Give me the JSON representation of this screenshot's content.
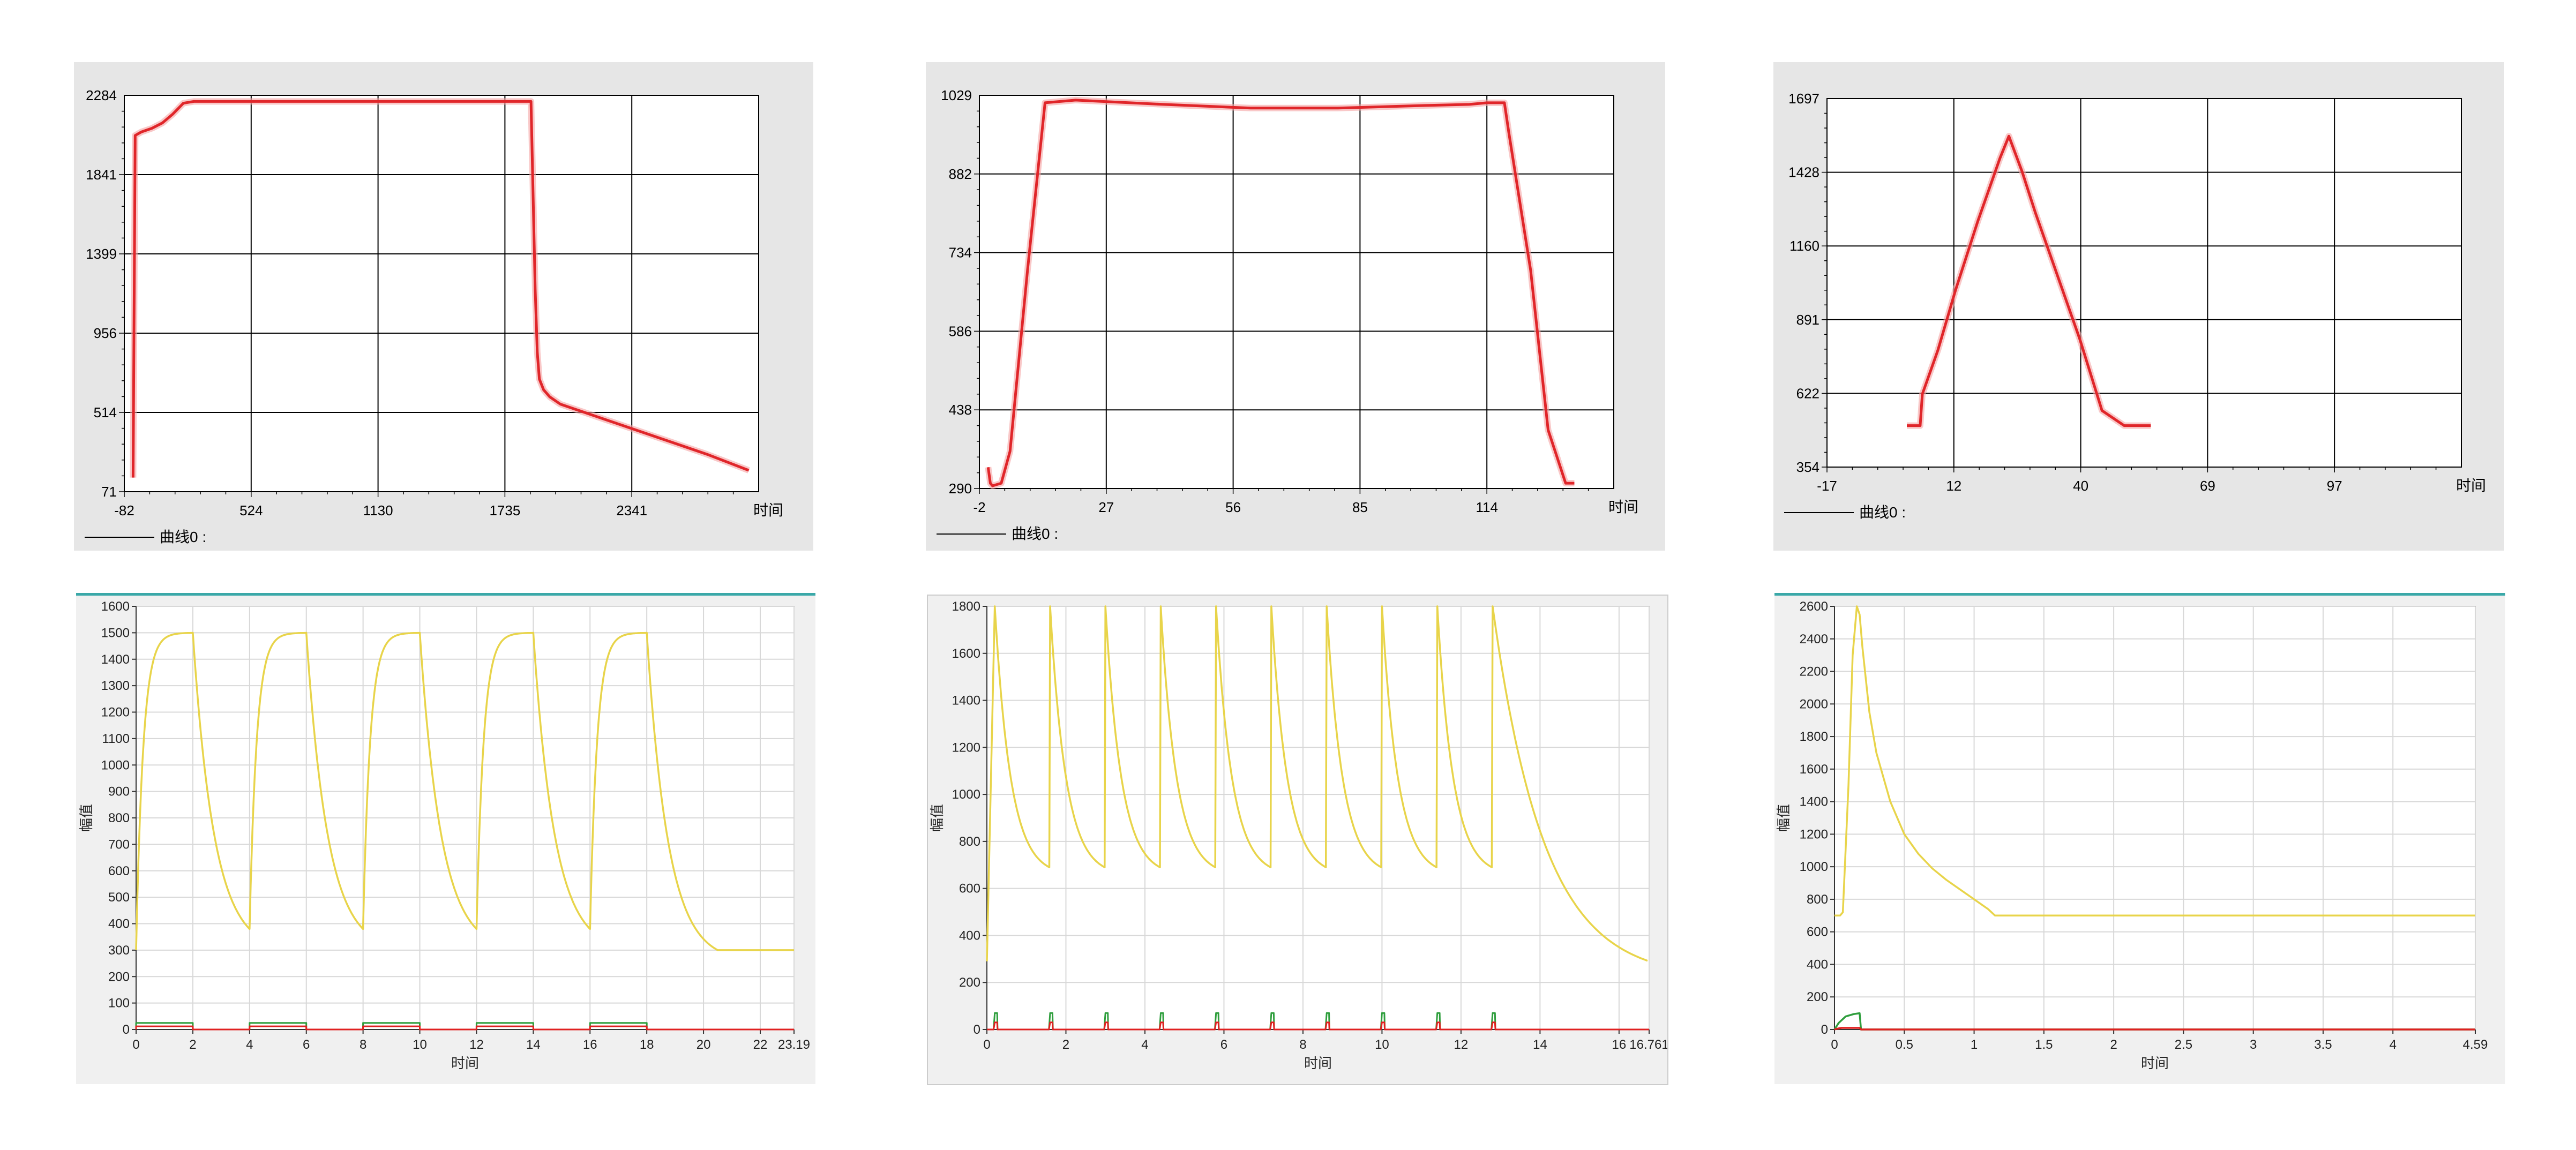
{
  "colors": {
    "red_curve": "#e0262a",
    "yellow": "#e8d44a",
    "green": "#2e9e3c",
    "red": "#e02020",
    "teal_border": "#3aa8a8"
  },
  "legend_label": "曲线0 :",
  "chart_data": [
    {
      "type": "line",
      "title": "",
      "xlabel": "时间",
      "ylabel": "",
      "xticks": [
        "-82",
        "524",
        "1130",
        "1735",
        "2341"
      ],
      "yticks": [
        "71",
        "514",
        "956",
        "1399",
        "1841",
        "2284"
      ],
      "xlim": [
        -82,
        2947
      ],
      "ylim": [
        71,
        2284
      ],
      "grid": true,
      "legend": "bottom-left",
      "series": [
        {
          "name": "曲线0",
          "x": [
            -40,
            -30,
            0,
            50,
            100,
            150,
            200,
            250,
            350,
            500,
            800,
            1200,
            1800,
            1860,
            1880,
            1890,
            1900,
            1920,
            1950,
            2000,
            2100,
            2400,
            2700,
            2900
          ],
          "y": [
            150,
            2060,
            2080,
            2100,
            2130,
            2180,
            2240,
            2250,
            2250,
            2250,
            2250,
            2250,
            2250,
            2250,
            1200,
            850,
            700,
            640,
            600,
            560,
            520,
            400,
            280,
            190
          ]
        }
      ]
    },
    {
      "type": "line",
      "title": "",
      "xlabel": "时间",
      "ylabel": "",
      "xticks": [
        "-2",
        "27",
        "56",
        "85",
        "114"
      ],
      "yticks": [
        "290",
        "438",
        "586",
        "734",
        "882",
        "1029"
      ],
      "xlim": [
        -2,
        143
      ],
      "ylim": [
        290,
        1029
      ],
      "grid": true,
      "legend": "bottom-left",
      "series": [
        {
          "name": "曲线0",
          "x": [
            0,
            0.5,
            1,
            3,
            5,
            9,
            13,
            20,
            40,
            60,
            80,
            100,
            110,
            114,
            118,
            119,
            124,
            128,
            132,
            134
          ],
          "y": [
            330,
            300,
            295,
            300,
            360,
            700,
            1015,
            1020,
            1012,
            1005,
            1005,
            1010,
            1012,
            1015,
            1015,
            960,
            700,
            400,
            300,
            300
          ]
        }
      ]
    },
    {
      "type": "line",
      "title": "",
      "xlabel": "时间",
      "ylabel": "",
      "xticks": [
        "-17",
        "12",
        "40",
        "69",
        "97"
      ],
      "yticks": [
        "354",
        "622",
        "891",
        "1160",
        "1428",
        "1697"
      ],
      "xlim": [
        -17,
        126
      ],
      "ylim": [
        354,
        1697
      ],
      "grid": true,
      "legend": "bottom-left",
      "series": [
        {
          "name": "曲线0",
          "x": [
            1,
            4,
            4.5,
            8,
            12,
            17,
            22,
            24,
            27,
            30,
            35,
            40,
            45,
            50,
            56
          ],
          "y": [
            505,
            505,
            620,
            780,
            1000,
            1250,
            1480,
            1560,
            1430,
            1280,
            1050,
            820,
            560,
            505,
            505
          ]
        }
      ]
    },
    {
      "type": "line",
      "title": "",
      "xlabel": "时间",
      "ylabel": "幅值",
      "xticks": [
        "0",
        "2",
        "4",
        "6",
        "8",
        "10",
        "12",
        "14",
        "16",
        "18",
        "20",
        "22",
        "23.19"
      ],
      "yticks": [
        "0",
        "100",
        "200",
        "300",
        "400",
        "500",
        "600",
        "700",
        "800",
        "900",
        "1000",
        "1100",
        "1200",
        "1300",
        "1400",
        "1500",
        "1600"
      ],
      "xlim": [
        0,
        23.19
      ],
      "ylim": [
        0,
        1600
      ],
      "grid": true,
      "series": [
        {
          "color": "yellow",
          "segments": [
            {
              "start": 0,
              "up": 2,
              "low": 300,
              "high": 1500,
              "tau_up": 0.25,
              "tau_down": 0.75,
              "down_end": 4
            },
            {
              "start": 4,
              "up": 2,
              "low": 380,
              "high": 1500,
              "tau_up": 0.25,
              "tau_down": 0.75,
              "down_end": 8
            },
            {
              "start": 8,
              "up": 2,
              "low": 380,
              "high": 1500,
              "tau_up": 0.25,
              "tau_down": 0.75,
              "down_end": 12
            },
            {
              "start": 12,
              "up": 2,
              "low": 380,
              "high": 1500,
              "tau_up": 0.25,
              "tau_down": 0.75,
              "down_end": 16
            },
            {
              "start": 16,
              "up": 2,
              "low": 380,
              "high": 1500,
              "tau_up": 0.25,
              "tau_down": 0.75,
              "down_end": 20.5
            }
          ],
          "tail": {
            "x": [
              20.5,
              23.19
            ],
            "y": [
              300,
              300
            ]
          }
        },
        {
          "color": "green",
          "pulses": [
            [
              0,
              2
            ],
            [
              4,
              6
            ],
            [
              8,
              10
            ],
            [
              12,
              14
            ],
            [
              16,
              18
            ]
          ],
          "value": 25,
          "base": 0
        },
        {
          "color": "red",
          "pulses": [
            [
              0,
              2
            ],
            [
              4,
              6
            ],
            [
              8,
              10
            ],
            [
              12,
              14
            ],
            [
              16,
              18
            ]
          ],
          "value": 12,
          "base": 0
        }
      ]
    },
    {
      "type": "line",
      "title": "",
      "xlabel": "时间",
      "ylabel": "幅值",
      "xticks": [
        "0",
        "2",
        "4",
        "6",
        "8",
        "10",
        "12",
        "14",
        "16",
        "16.761"
      ],
      "yticks": [
        "0",
        "200",
        "400",
        "600",
        "800",
        "1000",
        "1200",
        "1400",
        "1600",
        "1800"
      ],
      "xlim": [
        0,
        16.761
      ],
      "ylim": [
        0,
        1800
      ],
      "grid": true,
      "series": [
        {
          "color": "yellow",
          "spikes": [
            0.2,
            1.6,
            3.0,
            4.4,
            5.8,
            7.2,
            8.6,
            10.0,
            11.4,
            12.8
          ],
          "peak": 1800,
          "valley": 690,
          "first_low": 290,
          "tail_end": [
            16.761,
            290
          ]
        },
        {
          "color": "green",
          "spikes": [
            0.2,
            1.6,
            3.0,
            4.4,
            5.8,
            7.2,
            8.6,
            10.0,
            11.4,
            12.8
          ],
          "value": 70
        },
        {
          "color": "red",
          "spikes": [
            0.2,
            1.6,
            3.0,
            4.4,
            5.8,
            7.2,
            8.6,
            10.0,
            11.4,
            12.8
          ],
          "value": 30
        }
      ]
    },
    {
      "type": "line",
      "title": "",
      "xlabel": "时间",
      "ylabel": "幅值",
      "xticks": [
        "0",
        "0.5",
        "1",
        "1.5",
        "2",
        "2.5",
        "3",
        "3.5",
        "4",
        "4.59"
      ],
      "yticks": [
        "0",
        "200",
        "400",
        "600",
        "800",
        "1000",
        "1200",
        "1400",
        "1600",
        "1800",
        "2000",
        "2200",
        "2400",
        "2600"
      ],
      "xlim": [
        0,
        4.59
      ],
      "ylim": [
        0,
        2600
      ],
      "grid": true,
      "series": [
        {
          "color": "yellow",
          "x": [
            0.0,
            0.04,
            0.06,
            0.1,
            0.13,
            0.16,
            0.18,
            0.2,
            0.25,
            0.3,
            0.4,
            0.5,
            0.6,
            0.7,
            0.8,
            0.9,
            1.0,
            1.1,
            1.15,
            1.5,
            2.0,
            3.0,
            4.0,
            4.59
          ],
          "y": [
            700,
            700,
            720,
            1500,
            2300,
            2600,
            2550,
            2350,
            1950,
            1700,
            1400,
            1200,
            1080,
            990,
            920,
            860,
            800,
            740,
            700,
            700,
            700,
            700,
            700,
            700
          ]
        },
        {
          "color": "green",
          "x": [
            0.0,
            0.03,
            0.08,
            0.14,
            0.18,
            0.19,
            4.59
          ],
          "y": [
            0,
            40,
            80,
            95,
            100,
            0,
            0
          ]
        },
        {
          "color": "red",
          "x": [
            0.0,
            0.02,
            0.05,
            0.18,
            0.19,
            4.59
          ],
          "y": [
            0,
            5,
            10,
            10,
            0,
            0
          ]
        }
      ]
    }
  ]
}
